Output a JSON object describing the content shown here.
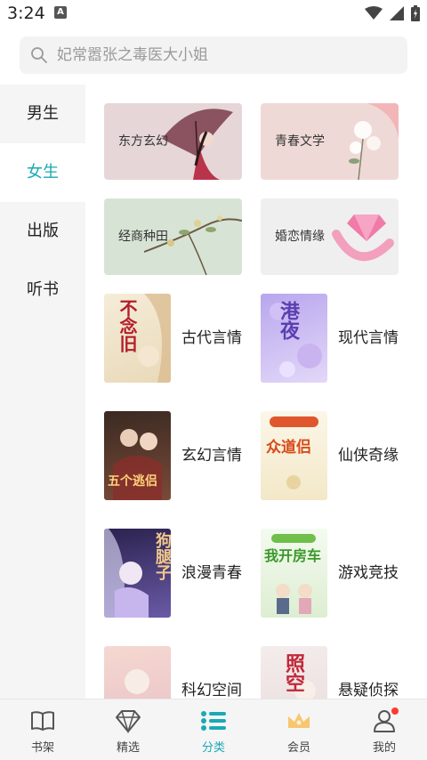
{
  "status_bar": {
    "time": "3:24",
    "notification_badge": "A"
  },
  "search": {
    "placeholder": "妃常嚣张之毒医大小姐"
  },
  "sidebar": {
    "items": [
      {
        "label": "男生",
        "active": false
      },
      {
        "label": "女生",
        "active": true
      },
      {
        "label": "出版",
        "active": false
      },
      {
        "label": "听书",
        "active": false
      }
    ]
  },
  "banners": [
    {
      "label": "东方玄幻"
    },
    {
      "label": "青春文学"
    },
    {
      "label": "经商种田"
    },
    {
      "label": "婚恋情缘"
    }
  ],
  "genres": [
    {
      "label": "古代言情",
      "cover_text": "不念旧"
    },
    {
      "label": "现代言情",
      "cover_text": "港夜"
    },
    {
      "label": "玄幻言情",
      "cover_text": "五个逃侣"
    },
    {
      "label": "仙侠奇缘",
      "cover_text": "众道侣"
    },
    {
      "label": "浪漫青春",
      "cover_text": "狗腿子"
    },
    {
      "label": "游戏竞技",
      "cover_text": "我开房车"
    },
    {
      "label": "科幻空间",
      "cover_text": ""
    },
    {
      "label": "悬疑侦探",
      "cover_text": "照空"
    }
  ],
  "bottom_nav": {
    "tabs": [
      {
        "label": "书架",
        "icon": "book-icon"
      },
      {
        "label": "精选",
        "icon": "diamond-icon"
      },
      {
        "label": "分类",
        "icon": "list-icon",
        "active": true
      },
      {
        "label": "会员",
        "icon": "crown-icon"
      },
      {
        "label": "我的",
        "icon": "person-icon"
      }
    ]
  },
  "colors": {
    "accent": "#1aa9b5",
    "sidebar_bg": "#f5f5f5",
    "badge": "#ff3b30"
  }
}
